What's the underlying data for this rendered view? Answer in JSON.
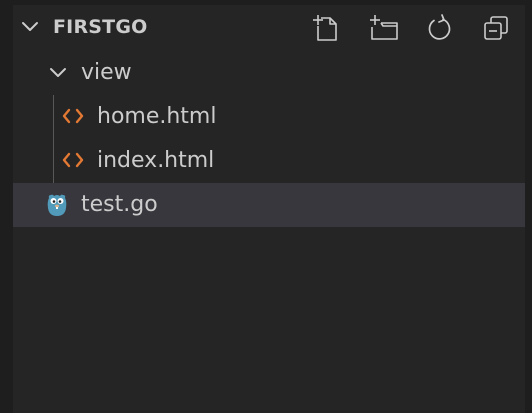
{
  "explorer": {
    "folder_title": "FIRSTGO",
    "actions": [
      {
        "name": "new-file-icon",
        "tooltip": "New File"
      },
      {
        "name": "new-folder-icon",
        "tooltip": "New Folder"
      },
      {
        "name": "refresh-icon",
        "tooltip": "Refresh Explorer"
      },
      {
        "name": "collapse-all-icon",
        "tooltip": "Collapse Folders in Explorer"
      }
    ],
    "tree": [
      {
        "label": "view",
        "type": "folder",
        "expanded": true,
        "depth": 1
      },
      {
        "label": "home.html",
        "type": "html",
        "depth": 2
      },
      {
        "label": "index.html",
        "type": "html",
        "depth": 2
      },
      {
        "label": "test.go",
        "type": "go",
        "depth": 1,
        "selected": true
      }
    ]
  },
  "colors": {
    "background": "#252526",
    "selected_row": "#37373d",
    "text": "#cccccc",
    "html_icon": "#e37933",
    "go_icon": "#519aba"
  }
}
